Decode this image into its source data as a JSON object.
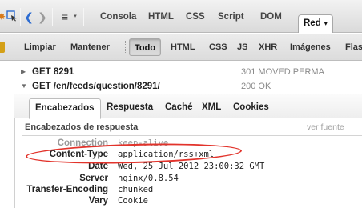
{
  "toolbar": {
    "menu_caret": "▾",
    "tabs": [
      {
        "label": "Consola"
      },
      {
        "label": "HTML"
      },
      {
        "label": "CSS"
      },
      {
        "label": "Script"
      },
      {
        "label": "DOM"
      },
      {
        "label": "Red",
        "active": true,
        "caret": "▾"
      }
    ],
    "icons": [
      "firebug-icon",
      "inspect-icon",
      "back-arrow-icon",
      "forward-arrow-icon",
      "menu-icon"
    ]
  },
  "filterbar": {
    "buttons": [
      {
        "label": "Limpiar"
      },
      {
        "label": "Mantener"
      },
      {
        "label": "Todo",
        "active": true
      },
      {
        "label": "HTML"
      },
      {
        "label": "CSS"
      },
      {
        "label": "JS"
      },
      {
        "label": "XHR"
      },
      {
        "label": "Imágenes"
      },
      {
        "label": "Flas"
      }
    ]
  },
  "requests": [
    {
      "method_url": "GET 8291",
      "status": "301 MOVED PERMA",
      "expanded": false
    },
    {
      "method_url": "GET /en/feeds/question/8291/",
      "status": "200 OK",
      "expanded": true
    }
  ],
  "detail": {
    "tabs": [
      "Encabezados",
      "Respuesta",
      "Caché",
      "XML",
      "Cookies"
    ],
    "active_tab": "Encabezados",
    "section_title": "Encabezados de respuesta",
    "view_source": "ver fuente",
    "headers": [
      {
        "name": "Connection",
        "value": "keep-alive"
      },
      {
        "name": "Content-Type",
        "value": "application/rss+xml"
      },
      {
        "name": "Date",
        "value": "Wed, 25 Jul 2012 23:00:32 GMT"
      },
      {
        "name": "Server",
        "value": "nginx/0.8.54"
      },
      {
        "name": "Transfer-Encoding",
        "value": "chunked"
      },
      {
        "name": "Vary",
        "value": "Cookie"
      }
    ]
  },
  "colors": {
    "highlight": "#e2332b",
    "accent_blue": "#2d6cd1"
  }
}
